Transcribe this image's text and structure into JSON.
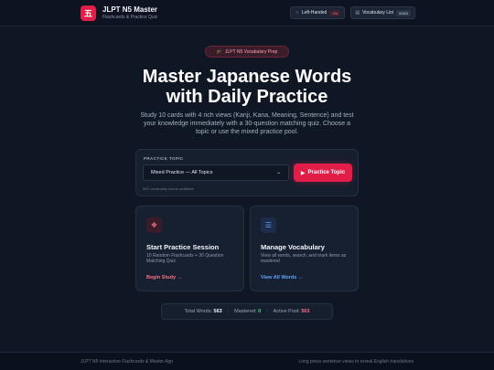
{
  "header": {
    "logo_char": "五",
    "title": "JLPT N5 Master",
    "subtitle": "Flashcards & Practice Quiz",
    "left_handed": {
      "label": "Left-Handed",
      "state": "ON"
    },
    "vocab_list": {
      "label": "Vocabulary List",
      "count": "0/563"
    }
  },
  "hero": {
    "badge": "JLPT N5 Vocabulary Prep",
    "title_line1": "Master Japanese Words",
    "title_line2": "with Daily Practice",
    "description": "Study 10 cards with 4 rich views (Kanji, Kana, Meaning, Sentence) and test your knowledge immediately with a 30-question matching quiz. Choose a topic or use the mixed practice pool."
  },
  "topic": {
    "label": "PRACTICE TOPIC",
    "selected": "Mixed Practice — All Topics",
    "button": "Practice Topic",
    "note": "563 vocabulary words available"
  },
  "cards": [
    {
      "title": "Start Practice Session",
      "desc": "10 Random Flashcards + 30 Question Matching Quiz",
      "link": "Begin Study →",
      "icon": "layers-icon"
    },
    {
      "title": "Manage Vocabulary",
      "desc": "View all words, search, and mark items as mastered",
      "link": "View All Words →",
      "icon": "list-icon"
    }
  ],
  "stats": {
    "total_label": "Total Words:",
    "total_value": "563",
    "mastered_label": "Mastered:",
    "mastered_value": "0",
    "pool_label": "Active Pool:",
    "pool_value": "563"
  },
  "footer": {
    "left": "JLPT N5 Interactive Flashcards & Master App",
    "right": "Long press sentence views to reveal English translations"
  },
  "colors": {
    "accent": "#e11d48",
    "background": "#0f1624",
    "blue": "#60a5fa",
    "green": "#4ade80"
  }
}
